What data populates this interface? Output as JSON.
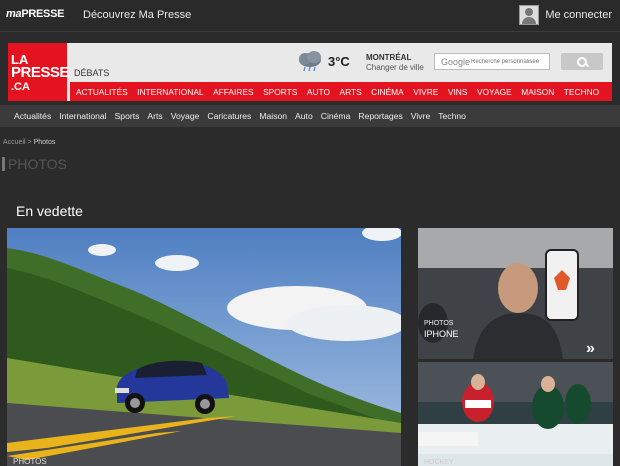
{
  "topbar": {
    "logo_ma": "ma",
    "logo_presse": "PRESSE",
    "discover": "Découvrez Ma Presse",
    "connect": "Me connecter"
  },
  "header": {
    "logo_la": "LA",
    "logo_presse": "PRESSE",
    "logo_ca": ".CA",
    "debats": "DÉBATS",
    "temperature": "3°C",
    "city": "MONTRÉAL",
    "change_city": "Changer de ville",
    "search_google": "Google",
    "search_placeholder": "Recherche personnalisée"
  },
  "red_nav": [
    "ACTUALITÉS",
    "INTERNATIONAL",
    "AFFAIRES",
    "SPORTS",
    "AUTO",
    "ARTS",
    "CINÉMA",
    "VIVRE",
    "VINS",
    "VOYAGE",
    "MAISON",
    "TECHNO"
  ],
  "sub_nav": [
    "Actualités",
    "International",
    "Sports",
    "Arts",
    "Voyage",
    "Caricatures",
    "Maison",
    "Auto",
    "Cinéma",
    "Reportages",
    "Vivre",
    "Techno"
  ],
  "breadcrumb": {
    "home": "Accueil",
    "separator": " > ",
    "current": "Photos"
  },
  "page_title": "PHOTOS",
  "section_title": "En vedette",
  "features": {
    "main_label": "PHOTOS",
    "side1_small": "PHOTOS",
    "side1_big": "IPHONE",
    "side2_small": "HOCKEY",
    "next_arrow": "»"
  },
  "colors": {
    "brand_red": "#e3141f",
    "dark_bg": "#2b2b2b"
  }
}
